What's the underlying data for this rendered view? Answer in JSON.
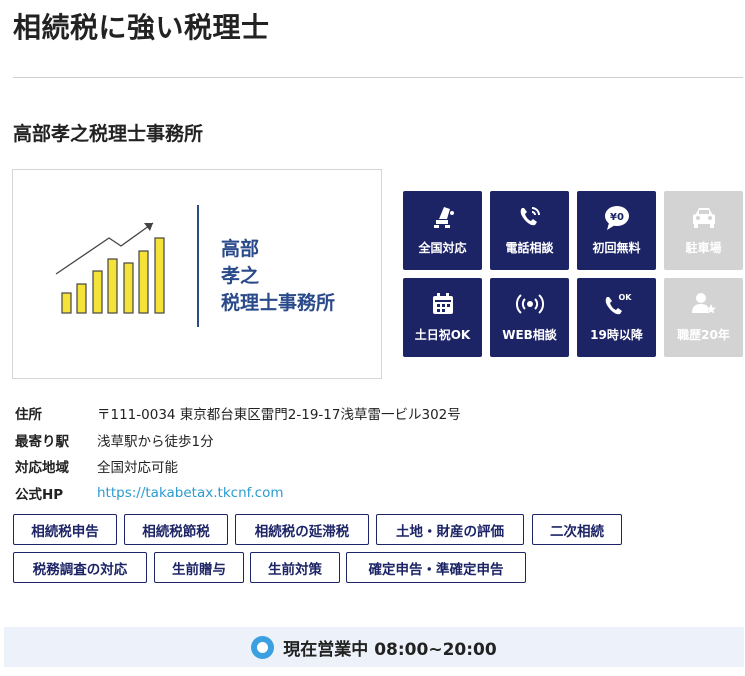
{
  "page_title": "相続税に強い税理士",
  "office": {
    "name": "高部孝之税理士事務所",
    "logo_lines": [
      "高部",
      "孝之",
      "税理士事務所"
    ]
  },
  "features": [
    {
      "label": "全国対応",
      "icon": "seat-icon",
      "active": true
    },
    {
      "label": "電話相談",
      "icon": "phone-icon",
      "active": true
    },
    {
      "label": "初回無料",
      "icon": "free-yen-bubble-icon",
      "active": true
    },
    {
      "label": "駐車場",
      "icon": "car-icon",
      "active": false
    },
    {
      "label": "土日祝OK",
      "icon": "calendar-icon",
      "active": true
    },
    {
      "label": "WEB相談",
      "icon": "broadcast-icon",
      "active": true
    },
    {
      "label": "19時以降",
      "icon": "phone-ok-icon",
      "active": true
    },
    {
      "label": "職歴20年",
      "icon": "person-star-icon",
      "active": false
    }
  ],
  "icon_texts": {
    "free": "¥0",
    "ok": "OK"
  },
  "info": {
    "address_label": "住所",
    "address": "〒111-0034 東京都台東区雷門2-19-17浅草雷一ビル302号",
    "station_label": "最寄り駅",
    "station": "浅草駅から徒歩1分",
    "area_label": "対応地域",
    "area": "全国対応可能",
    "hp_label": "公式HP",
    "hp": "https://takabetax.tkcnf.com"
  },
  "tags": [
    "相続税申告",
    "相続税節税",
    "相続税の延滞税",
    "土地・財産の評価",
    "二次相続",
    "税務調査の対応",
    "生前贈与",
    "生前対策",
    "確定申告・準確定申告"
  ],
  "status": {
    "text": "現在営業中 08:00~20:00"
  },
  "colors": {
    "navy": "#1c2466",
    "inactive": "#d3d3d3",
    "link": "#2b9bd0",
    "logo_text": "#2a4a8a",
    "bar_yellow": "#f5e33a"
  }
}
